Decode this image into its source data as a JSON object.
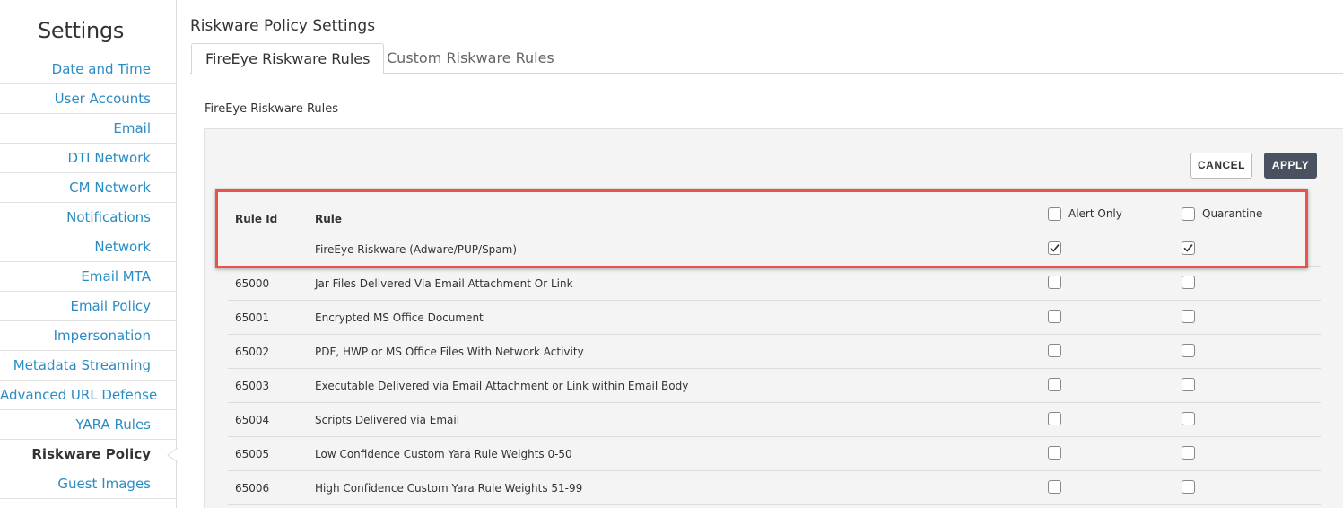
{
  "sidebar": {
    "title": "Settings",
    "items": [
      {
        "label": "Date and Time"
      },
      {
        "label": "User Accounts"
      },
      {
        "label": "Email"
      },
      {
        "label": "DTI Network"
      },
      {
        "label": "CM Network"
      },
      {
        "label": "Notifications"
      },
      {
        "label": "Network"
      },
      {
        "label": "Email MTA"
      },
      {
        "label": "Email Policy"
      },
      {
        "label": "Impersonation"
      },
      {
        "label": "Metadata Streaming"
      },
      {
        "label": "Advanced URL Defense"
      },
      {
        "label": "YARA Rules"
      },
      {
        "label": "Riskware Policy",
        "active": true
      },
      {
        "label": "Guest Images"
      }
    ]
  },
  "page": {
    "title": "Riskware Policy Settings",
    "tabs": [
      {
        "label": "FireEye Riskware Rules",
        "active": true
      },
      {
        "label": "Custom Riskware Rules",
        "active": false
      }
    ],
    "section_label": "FireEye Riskware Rules"
  },
  "actions": {
    "cancel_label": "CANCEL",
    "apply_label": "APPLY"
  },
  "table": {
    "headers": {
      "rule_id": "Rule Id",
      "rule": "Rule",
      "alert_only": "Alert Only",
      "quarantine": "Quarantine"
    },
    "header_checks": {
      "alert_only": false,
      "quarantine": false
    },
    "rows": [
      {
        "id": "",
        "rule": "FireEye Riskware (Adware/PUP/Spam)",
        "alert_only": true,
        "quarantine": true
      },
      {
        "id": "65000",
        "rule": "Jar Files Delivered Via Email Attachment Or Link",
        "alert_only": false,
        "quarantine": false
      },
      {
        "id": "65001",
        "rule": "Encrypted MS Office Document",
        "alert_only": false,
        "quarantine": false
      },
      {
        "id": "65002",
        "rule": "PDF, HWP or MS Office Files With Network Activity",
        "alert_only": false,
        "quarantine": false
      },
      {
        "id": "65003",
        "rule": "Executable Delivered via Email Attachment or Link within Email Body",
        "alert_only": false,
        "quarantine": false
      },
      {
        "id": "65004",
        "rule": "Scripts Delivered via Email",
        "alert_only": false,
        "quarantine": false
      },
      {
        "id": "65005",
        "rule": "Low Confidence Custom Yara Rule Weights 0-50",
        "alert_only": false,
        "quarantine": false
      },
      {
        "id": "65006",
        "rule": "High Confidence Custom Yara Rule Weights 51-99",
        "alert_only": false,
        "quarantine": false
      }
    ]
  },
  "colors": {
    "link": "#2b8cc4",
    "apply_bg": "#4a5261",
    "highlight": "#e8534a"
  }
}
